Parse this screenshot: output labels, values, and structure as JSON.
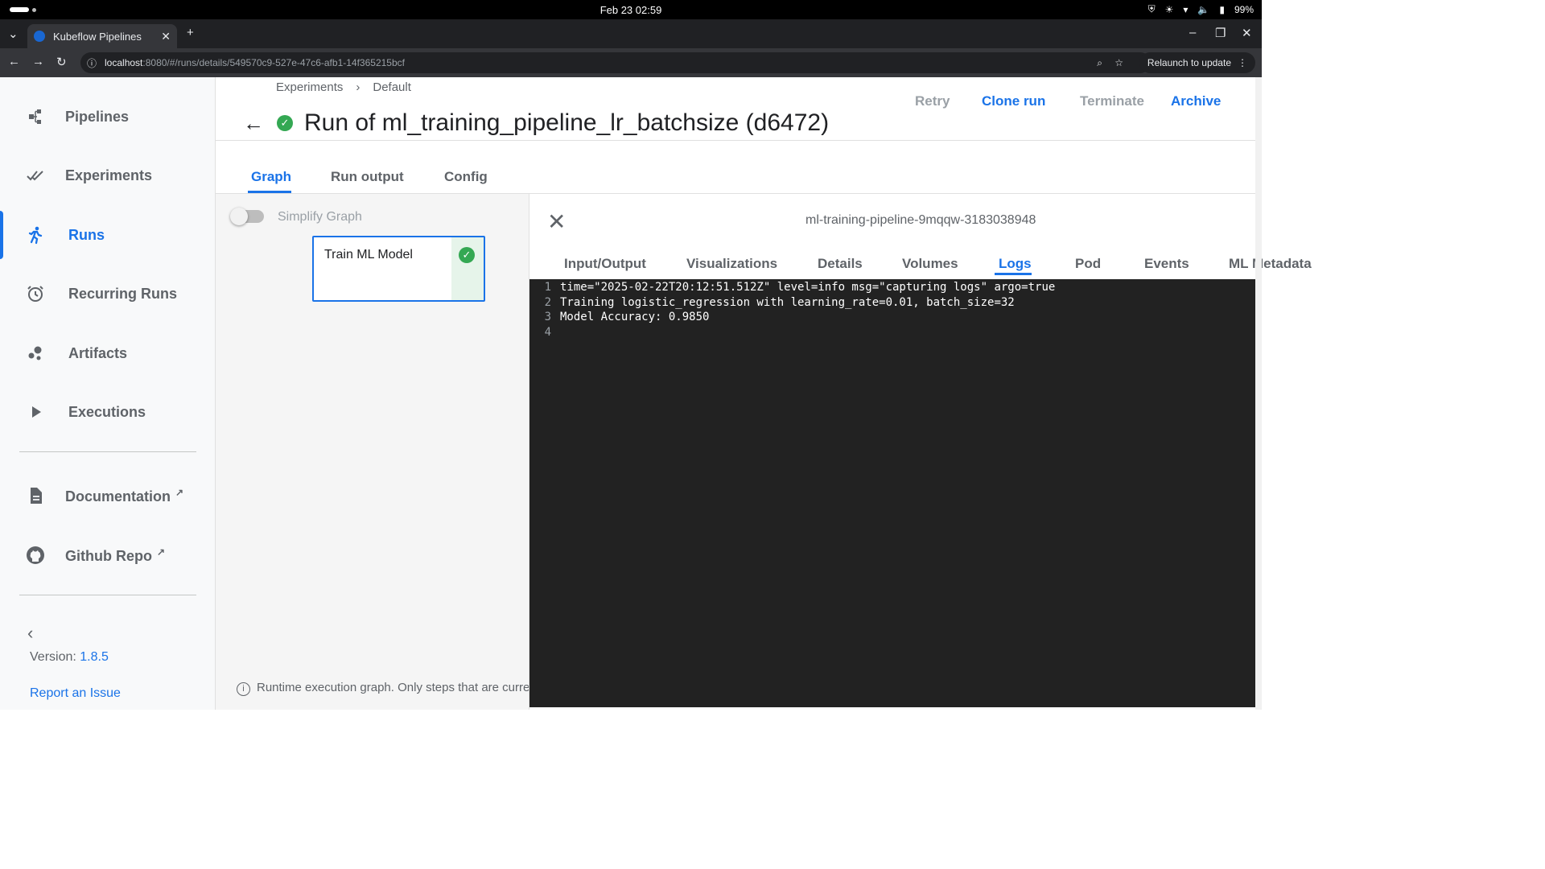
{
  "os": {
    "clock": "Feb 23  02:59",
    "battery": "99%"
  },
  "browser": {
    "tab_title": "Kubeflow Pipelines",
    "url_host": "localhost",
    "url_path": ":8080/#/runs/details/549570c9-527e-47c6-afb1-14f365215bcf",
    "relaunch": "Relaunch to update"
  },
  "sidebar": {
    "items": [
      {
        "label": "Pipelines",
        "icon": "pipelines-icon"
      },
      {
        "label": "Experiments",
        "icon": "experiments-icon"
      },
      {
        "label": "Runs",
        "icon": "runs-icon",
        "active": true
      },
      {
        "label": "Recurring Runs",
        "icon": "alarm-icon"
      },
      {
        "label": "Artifacts",
        "icon": "artifacts-icon"
      },
      {
        "label": "Executions",
        "icon": "play-icon"
      }
    ],
    "links": [
      {
        "label": "Documentation",
        "icon": "document-icon"
      },
      {
        "label": "Github Repo",
        "icon": "github-icon"
      }
    ],
    "version_prefix": "Version: ",
    "version": "1.8.5",
    "report": "Report an Issue"
  },
  "header": {
    "breadcrumb": [
      "Experiments",
      "Default"
    ],
    "breadcrumb_sep": "›",
    "title": "Run of ml_training_pipeline_lr_batchsize (d6472)",
    "actions": [
      {
        "label": "Retry",
        "enabled": false
      },
      {
        "label": "Clone run",
        "enabled": true
      },
      {
        "label": "Terminate",
        "enabled": false
      },
      {
        "label": "Archive",
        "enabled": true
      }
    ]
  },
  "tabs": [
    {
      "label": "Graph",
      "active": true
    },
    {
      "label": "Run output"
    },
    {
      "label": "Config"
    }
  ],
  "graph": {
    "simplify_label": "Simplify Graph",
    "node_label": "Train ML Model",
    "note": "Runtime execution graph. Only steps that are currently running or have already completed are shown."
  },
  "details": {
    "node_id": "ml-training-pipeline-9mqqw-3183038948",
    "tabs": [
      "Input/Output",
      "Visualizations",
      "Details",
      "Volumes",
      "Logs",
      "Pod",
      "Events",
      "ML Metadata"
    ],
    "active_tab": "Logs",
    "logs": [
      {
        "n": "1",
        "text": "time=\"2025-02-22T20:12:51.512Z\" level=info msg=\"capturing logs\" argo=true"
      },
      {
        "n": "2",
        "text": "Training logistic_regression with learning_rate=0.01, batch_size=32"
      },
      {
        "n": "3",
        "text": "Model Accuracy: 0.9850"
      },
      {
        "n": "4",
        "text": ""
      }
    ]
  }
}
